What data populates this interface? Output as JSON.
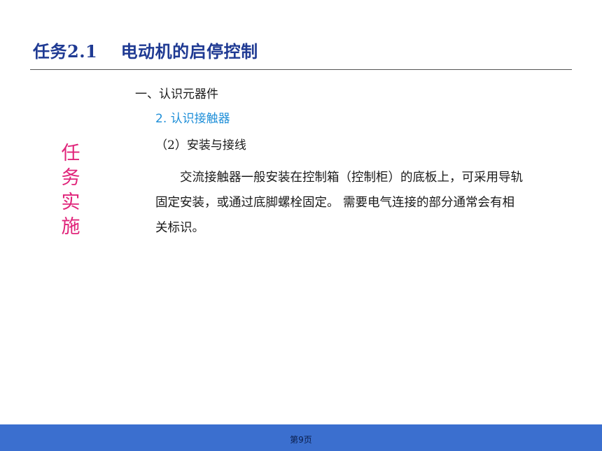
{
  "slide": {
    "title": "任务2.1　 电动机的启停控制",
    "side_label": [
      "任",
      "务",
      "实",
      "施"
    ],
    "heading1": "一、认识元器件",
    "heading2": "2. 认识接触器",
    "heading3": "（2）安装与接线",
    "paragraph_lines": [
      "　　交流接触器一般安装在控制箱（控制柜）的底板上，可采用导轨",
      "固定安装，或通过底脚螺栓固定。 需要电气连接的部分通常会有相",
      "关标识。"
    ],
    "page_number": "第9页"
  },
  "colors": {
    "title": "#1f3a93",
    "side_label": "#e0247a",
    "heading2": "#1f8fd8",
    "footer_bar": "#3b6fcf"
  }
}
